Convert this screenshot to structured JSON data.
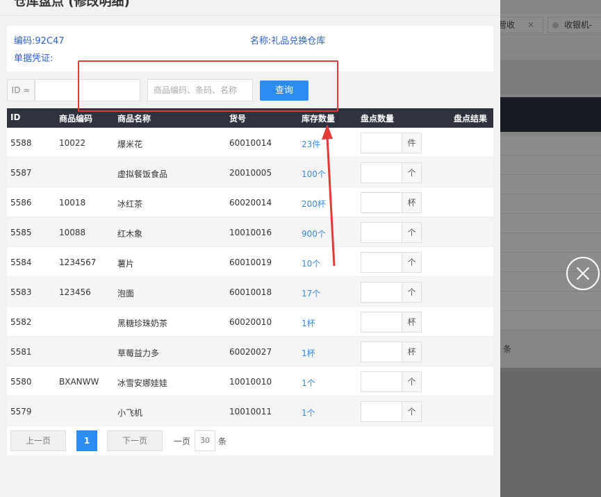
{
  "modal": {
    "title": "仓库盘点 (修改明细)",
    "code_text": "编码:92C47",
    "name_text": "名称:礼品兑换仓库",
    "voucher_text": "单据凭证:"
  },
  "search": {
    "id_label": "ID ≈",
    "id_value": "",
    "keyword_placeholder": "商品编码、条码、名称",
    "query_label": "查询"
  },
  "table": {
    "headers": [
      "ID",
      "商品编码",
      "商品名称",
      "货号",
      "库存数量",
      "盘点数量",
      "盘点结果"
    ],
    "rows": [
      {
        "id": "5588",
        "code": "10022",
        "name": "爆米花",
        "sku": "60010014",
        "stock": "23件",
        "unit": "件"
      },
      {
        "id": "5587",
        "code": "",
        "name": "虚拟餐饭食品",
        "sku": "20010005",
        "stock": "100个",
        "unit": "个"
      },
      {
        "id": "5586",
        "code": "10018",
        "name": "冰红茶",
        "sku": "60020014",
        "stock": "200杯",
        "unit": "杯"
      },
      {
        "id": "5585",
        "code": "10088",
        "name": "红木象",
        "sku": "10010016",
        "stock": "900个",
        "unit": "个"
      },
      {
        "id": "5584",
        "code": "1234567",
        "name": "薯片",
        "sku": "60010019",
        "stock": "10个",
        "unit": "个"
      },
      {
        "id": "5583",
        "code": "123456",
        "name": "泡面",
        "sku": "60010018",
        "stock": "17个",
        "unit": "个"
      },
      {
        "id": "5582",
        "code": "",
        "name": "黑糖珍珠奶茶",
        "sku": "60020010",
        "stock": "1杯",
        "unit": "杯"
      },
      {
        "id": "5581",
        "code": "",
        "name": "草莓益力多",
        "sku": "60020027",
        "stock": "1杯",
        "unit": "杯"
      },
      {
        "id": "5580",
        "code": "BXANWW",
        "name": "冰雪安娜娃娃",
        "sku": "10010010",
        "stock": "1个",
        "unit": "个"
      },
      {
        "id": "5579",
        "code": "",
        "name": "小飞机",
        "sku": "10010011",
        "stock": "1个",
        "unit": "个"
      }
    ]
  },
  "pager": {
    "prev_label": "上一页",
    "current_page": "1",
    "next_label": "下一页",
    "per_page_prefix": "一页",
    "per_page_value": "30",
    "per_page_suffix": "条"
  },
  "background": {
    "tab1_label": "营收",
    "tab2_label": "收银机-",
    "tiao_label": "条"
  },
  "colors": {
    "accent": "#2d8cf0",
    "header_dark": "#2f3340",
    "annotation_red": "#e53935"
  }
}
